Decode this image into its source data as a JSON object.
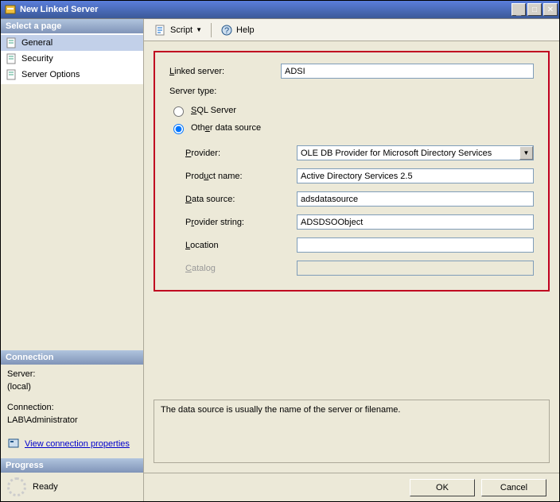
{
  "titlebar": {
    "title": "New Linked Server"
  },
  "winbtns": {
    "min": "_",
    "max": "❐",
    "close": "✕"
  },
  "left": {
    "select_page": "Select a page",
    "nav": [
      {
        "label": "General"
      },
      {
        "label": "Security"
      },
      {
        "label": "Server Options"
      }
    ],
    "connection_hdr": "Connection",
    "server_lbl": "Server:",
    "server_val": "(local)",
    "conn_lbl": "Connection:",
    "conn_val": "LAB\\Administrator",
    "view_conn": "View connection properties",
    "progress_hdr": "Progress",
    "status": "Ready"
  },
  "toolbar": {
    "script": "Script",
    "help": "Help"
  },
  "form": {
    "linked_server_lbl": "Linked server:",
    "linked_server_val": "ADSI",
    "server_type_lbl": "Server type:",
    "radio_sql": "SQL Server",
    "radio_other": "Other data source",
    "provider_lbl": "Provider:",
    "provider_val": "OLE DB Provider for Microsoft Directory Services",
    "product_lbl": "Product name:",
    "product_val": "Active Directory Services 2.5",
    "datasource_lbl": "Data source:",
    "datasource_val": "adsdatasource",
    "provstring_lbl": "Provider string:",
    "provstring_val": "ADSDSOObject",
    "location_lbl": "Location",
    "location_val": "",
    "catalog_lbl": "Catalog",
    "catalog_val": ""
  },
  "info": "The data source is usually the name of the server or filename.",
  "buttons": {
    "ok": "OK",
    "cancel": "Cancel"
  }
}
